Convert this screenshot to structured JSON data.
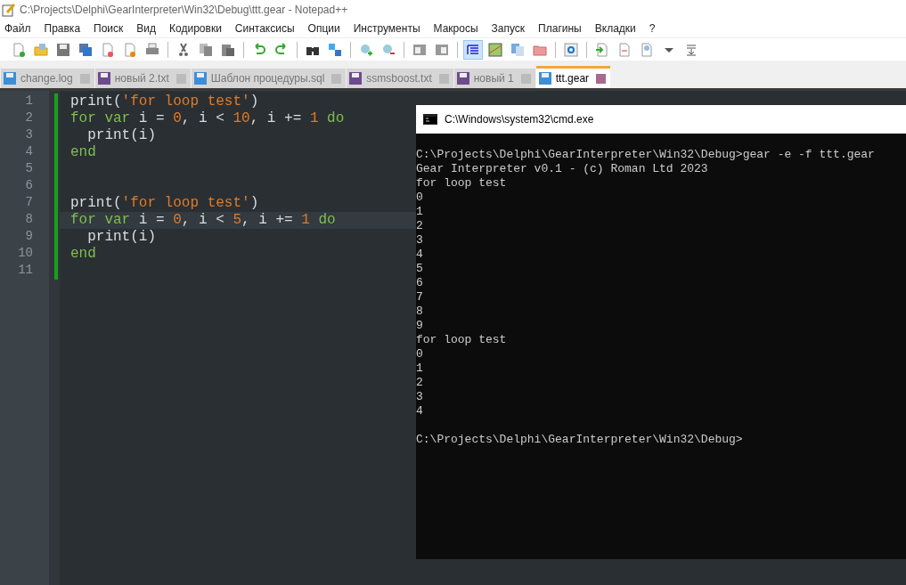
{
  "window": {
    "title": "C:\\Projects\\Delphi\\GearInterpreter\\Win32\\Debug\\ttt.gear - Notepad++"
  },
  "menu": [
    "Файл",
    "Правка",
    "Поиск",
    "Вид",
    "Кодировки",
    "Синтаксисы",
    "Опции",
    "Инструменты",
    "Макросы",
    "Запуск",
    "Плагины",
    "Вкладки",
    "?"
  ],
  "tabs": [
    {
      "label": "change.log",
      "selected": false,
      "modified": false
    },
    {
      "label": "новый 2.txt",
      "selected": false,
      "modified": true
    },
    {
      "label": "Шаблон процедуры.sql",
      "selected": false,
      "modified": false
    },
    {
      "label": "ssmsboost.txt",
      "selected": false,
      "modified": true
    },
    {
      "label": "новый 1",
      "selected": false,
      "modified": true
    },
    {
      "label": "ttt.gear",
      "selected": true,
      "modified": false
    }
  ],
  "editor": {
    "lines": [
      {
        "number": "1",
        "current": false,
        "tokens": [
          {
            "kind": "plain",
            "text": "print("
          },
          {
            "kind": "string",
            "text": "'for loop test'"
          },
          {
            "kind": "plain",
            "text": ")"
          }
        ]
      },
      {
        "number": "2",
        "current": false,
        "tokens": [
          {
            "kind": "keyword",
            "text": "for var"
          },
          {
            "kind": "plain",
            "text": " i = "
          },
          {
            "kind": "number",
            "text": "0"
          },
          {
            "kind": "plain",
            "text": ", i < "
          },
          {
            "kind": "number",
            "text": "10"
          },
          {
            "kind": "plain",
            "text": ", i += "
          },
          {
            "kind": "number",
            "text": "1"
          },
          {
            "kind": "keyword",
            "text": " do"
          }
        ]
      },
      {
        "number": "3",
        "current": false,
        "tokens": [
          {
            "kind": "plain",
            "text": "  print(i)"
          }
        ]
      },
      {
        "number": "4",
        "current": false,
        "tokens": [
          {
            "kind": "keyword",
            "text": "end"
          }
        ]
      },
      {
        "number": "5",
        "current": false
      },
      {
        "number": "6",
        "current": false
      },
      {
        "number": "7",
        "current": false,
        "tokens": [
          {
            "kind": "plain",
            "text": "print("
          },
          {
            "kind": "string",
            "text": "'for loop test'"
          },
          {
            "kind": "plain",
            "text": ")"
          }
        ]
      },
      {
        "number": "8",
        "current": true,
        "tokens": [
          {
            "kind": "keyword",
            "text": "for var"
          },
          {
            "kind": "plain",
            "text": " i = "
          },
          {
            "kind": "number",
            "text": "0"
          },
          {
            "kind": "plain",
            "text": ", i < "
          },
          {
            "kind": "number",
            "text": "5"
          },
          {
            "kind": "plain",
            "text": ", i += "
          },
          {
            "kind": "number",
            "text": "1"
          },
          {
            "kind": "keyword",
            "text": " do"
          }
        ]
      },
      {
        "number": "9",
        "current": false,
        "tokens": [
          {
            "kind": "plain",
            "text": "  print(i)"
          }
        ]
      },
      {
        "number": "10",
        "current": false,
        "tokens": [
          {
            "kind": "keyword",
            "text": "end"
          }
        ]
      },
      {
        "number": "11",
        "current": false
      }
    ]
  },
  "console": {
    "title": "C:\\Windows\\system32\\cmd.exe",
    "lines": [
      {
        "kind": "blank"
      },
      {
        "kind": "text",
        "text": "C:\\Projects\\Delphi\\GearInterpreter\\Win32\\Debug>gear -e -f ttt.gear"
      },
      {
        "kind": "text",
        "text": "Gear Interpreter v0.1 - (c) Roman Ltd 2023"
      },
      {
        "kind": "text",
        "text": "for loop test"
      },
      {
        "kind": "text",
        "text": "0"
      },
      {
        "kind": "text",
        "text": "1"
      },
      {
        "kind": "text",
        "text": "2"
      },
      {
        "kind": "text",
        "text": "3"
      },
      {
        "kind": "text",
        "text": "4"
      },
      {
        "kind": "text",
        "text": "5"
      },
      {
        "kind": "text",
        "text": "6"
      },
      {
        "kind": "text",
        "text": "7"
      },
      {
        "kind": "text",
        "text": "8"
      },
      {
        "kind": "text",
        "text": "9"
      },
      {
        "kind": "text",
        "text": "for loop test"
      },
      {
        "kind": "text",
        "text": "0"
      },
      {
        "kind": "text",
        "text": "1"
      },
      {
        "kind": "text",
        "text": "2"
      },
      {
        "kind": "text",
        "text": "3"
      },
      {
        "kind": "text",
        "text": "4"
      },
      {
        "kind": "blank"
      },
      {
        "kind": "text",
        "text": "C:\\Projects\\Delphi\\GearInterpreter\\Win32\\Debug>"
      }
    ]
  }
}
